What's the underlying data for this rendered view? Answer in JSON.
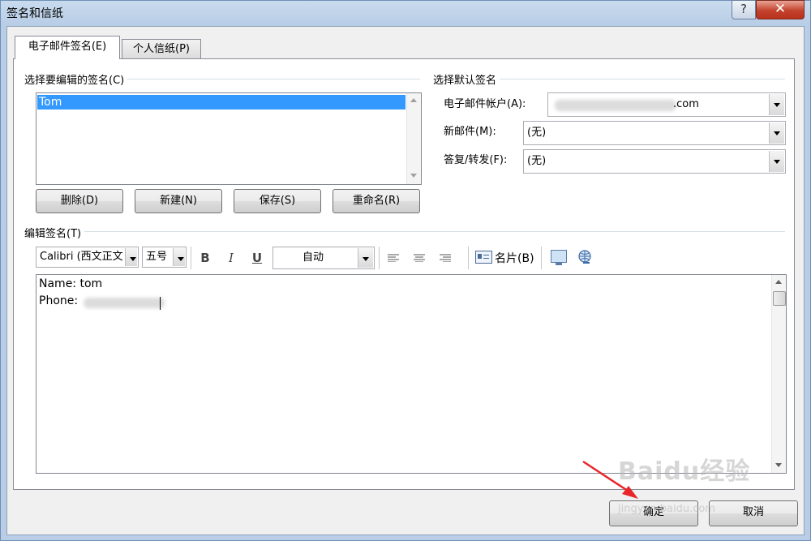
{
  "window": {
    "title": "签名和信纸",
    "help_symbol": "?",
    "close_symbol": "✕"
  },
  "tabs": [
    {
      "label": "电子邮件签名(E)"
    },
    {
      "label": "个人信纸(P)"
    }
  ],
  "select_signature": {
    "heading": "选择要编辑的签名(C)",
    "items": [
      "Tom"
    ],
    "buttons": {
      "delete": "删除(D)",
      "new": "新建(N)",
      "save": "保存(S)",
      "rename": "重命名(R)"
    }
  },
  "default_signature": {
    "heading": "选择默认签名",
    "account_label": "电子邮件帐户(A):",
    "account_value": ".com",
    "new_mail_label": "新邮件(M):",
    "new_mail_value": "(无)",
    "reply_label": "答复/转发(F):",
    "reply_value": "(无)"
  },
  "edit_signature": {
    "heading": "编辑签名(T)",
    "font": "Calibri (西文正文",
    "size": "五号",
    "bold": "B",
    "italic": "I",
    "underline": "U",
    "color": "自动",
    "business_card": "名片(B)",
    "lines": [
      "Name: tom",
      "Phone:"
    ]
  },
  "footer": {
    "ok": "确定",
    "cancel": "取消"
  },
  "watermark": {
    "text": "Baidu经验",
    "sub": "jingyan.baidu.com"
  },
  "colors": {
    "selection": "#3399ff",
    "close_red": "#c3432d",
    "arrow": "#e8262a"
  }
}
